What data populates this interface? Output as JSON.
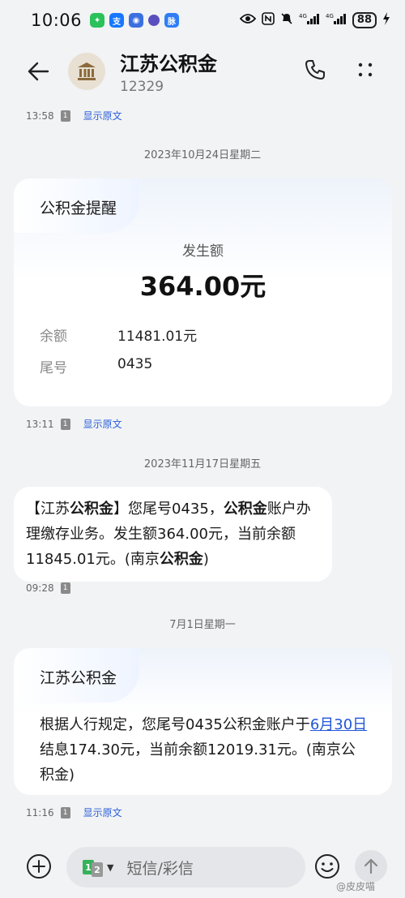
{
  "status_bar": {
    "time": "10:06",
    "network_1": "4G",
    "network_2": "4G",
    "battery": "88"
  },
  "header": {
    "contact_name": "江苏公积金",
    "contact_number": "12329"
  },
  "messages": {
    "m0": {
      "time": "13:58",
      "sim": "1",
      "show_original": "显示原文"
    },
    "date1": "2023年10月24日星期二",
    "card1": {
      "title": "公积金提醒",
      "amount_label": "发生额",
      "amount": "364.00元",
      "balance_label": "余额",
      "balance": "11481.01元",
      "tail_label": "尾号",
      "tail": "0435",
      "time": "13:11",
      "sim": "1",
      "show_original": "显示原文"
    },
    "date2": "2023年11月17日星期五",
    "bubble2": {
      "p1": "【江苏",
      "p2": "公积金",
      "p3": "】您尾号0435，",
      "p4": "公积金",
      "p5": "账户办理缴存业务。发生额364.00元，当前余额11845.01元。(南京",
      "p6": "公积金",
      "p7": ")",
      "time": "09:28",
      "sim": "1"
    },
    "date3": "7月1日星期一",
    "card3": {
      "title": "江苏公积金",
      "body_1": "根据人行规定，您尾号0435公积金账户于",
      "body_link": "6月30日",
      "body_2": "结息174.30元，当前余额12019.31元。(南京公积金)",
      "time": "11:16",
      "sim": "1",
      "show_original": "显示原文"
    }
  },
  "input_bar": {
    "sim_1": "1",
    "sim_2": "2",
    "placeholder": "短信/彩信"
  },
  "watermark": "@皮皮喵"
}
